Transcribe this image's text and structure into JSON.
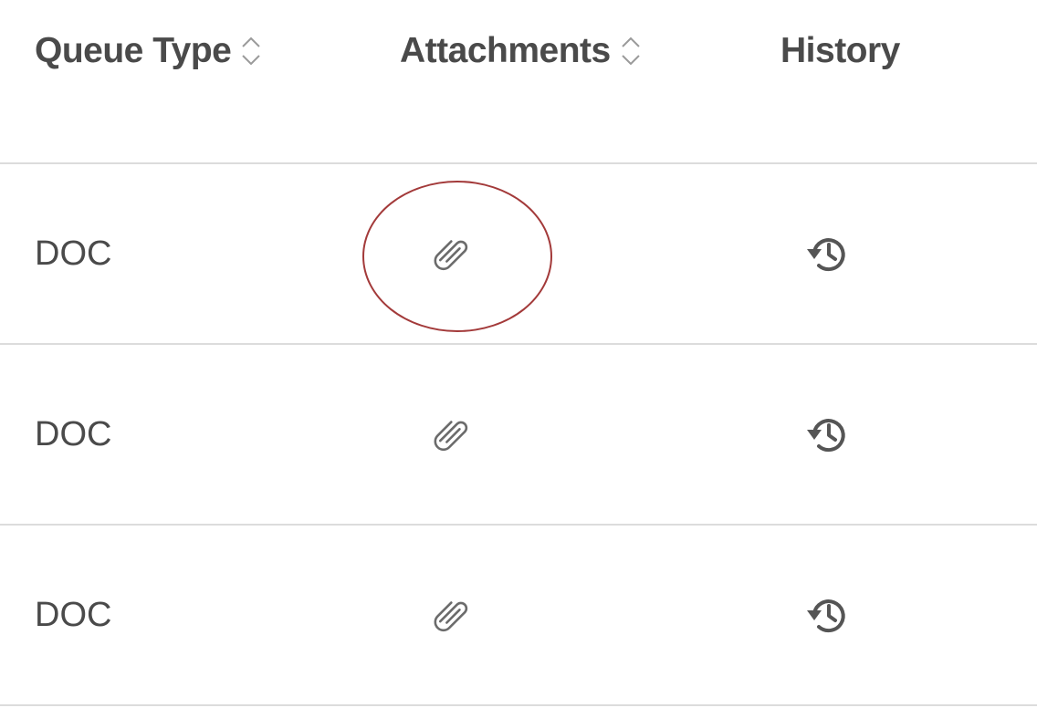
{
  "table": {
    "columns": [
      {
        "label": "Queue Type",
        "sortable": true
      },
      {
        "label": "Attachments",
        "sortable": true
      },
      {
        "label": "History",
        "sortable": false
      }
    ],
    "rows": [
      {
        "queue_type": "DOC",
        "attachment_icon": "paperclip-icon",
        "history_icon": "history-icon"
      },
      {
        "queue_type": "DOC",
        "attachment_icon": "paperclip-icon",
        "history_icon": "history-icon"
      },
      {
        "queue_type": "DOC",
        "attachment_icon": "paperclip-icon",
        "history_icon": "history-icon"
      }
    ]
  },
  "annotation": {
    "type": "highlight-circle",
    "target": "row 1 attachments icon",
    "color": "#a33a3a"
  },
  "colors": {
    "text": "#4a4a4a",
    "icon": "#6b6b6b",
    "divider": "#dcdcdc",
    "sort_arrows": "#9a9a9a"
  }
}
